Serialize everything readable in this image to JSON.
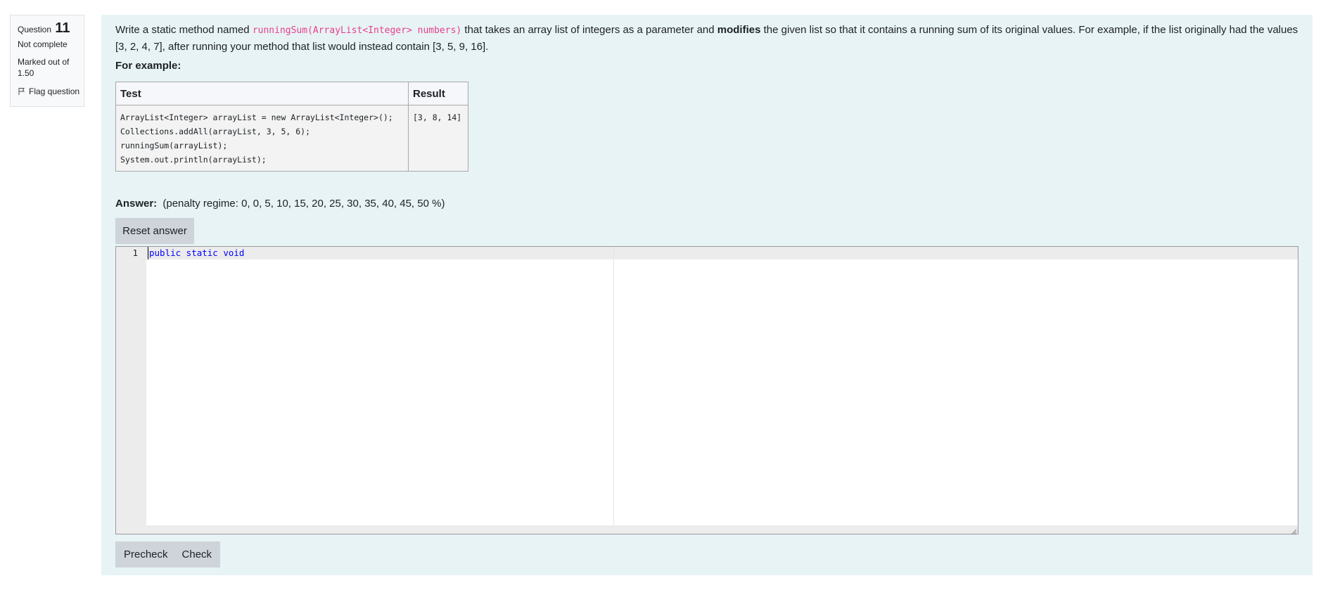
{
  "question_info": {
    "label": "Question",
    "number": "11",
    "state": "Not complete",
    "grade_line1": "Marked out of",
    "grade_line2": "1.50",
    "flag_label": "Flag question",
    "flag_icon": "flag-icon"
  },
  "question": {
    "text_before": "Write a static method named ",
    "code": "runningSum(ArrayList<Integer> numbers)",
    "text_middle": " that takes an array list of integers as a parameter and ",
    "bold": "modifies",
    "text_after": " the given list so that it contains a running sum of its original values. For example, if the list originally had the values [3, 2, 4, 7], after running your method that list would instead contain [3, 5, 9, 16].",
    "for_example": "For example:"
  },
  "examples_table": {
    "headers": [
      "Test",
      "Result"
    ],
    "rows": [
      {
        "test": "ArrayList<Integer> arrayList = new ArrayList<Integer>();\nCollections.addAll(arrayList, 3, 5, 6);\nrunningSum(arrayList);\nSystem.out.println(arrayList);",
        "result": "[3, 8, 14]"
      }
    ]
  },
  "answer": {
    "label": "Answer:",
    "penalty": "(penalty regime: 0, 0, 5, 10, 15, 20, 25, 30, 35, 40, 45, 50 %)",
    "reset_label": "Reset answer"
  },
  "editor": {
    "line_number": "1",
    "code": "public static void"
  },
  "actions": {
    "precheck_label": "Precheck",
    "check_label": "Check"
  },
  "colors": {
    "content_bg": "#e7f3f5",
    "button_bg": "#ced4da",
    "inline_code": "#e83e8c",
    "keyword": "#0000ff"
  }
}
